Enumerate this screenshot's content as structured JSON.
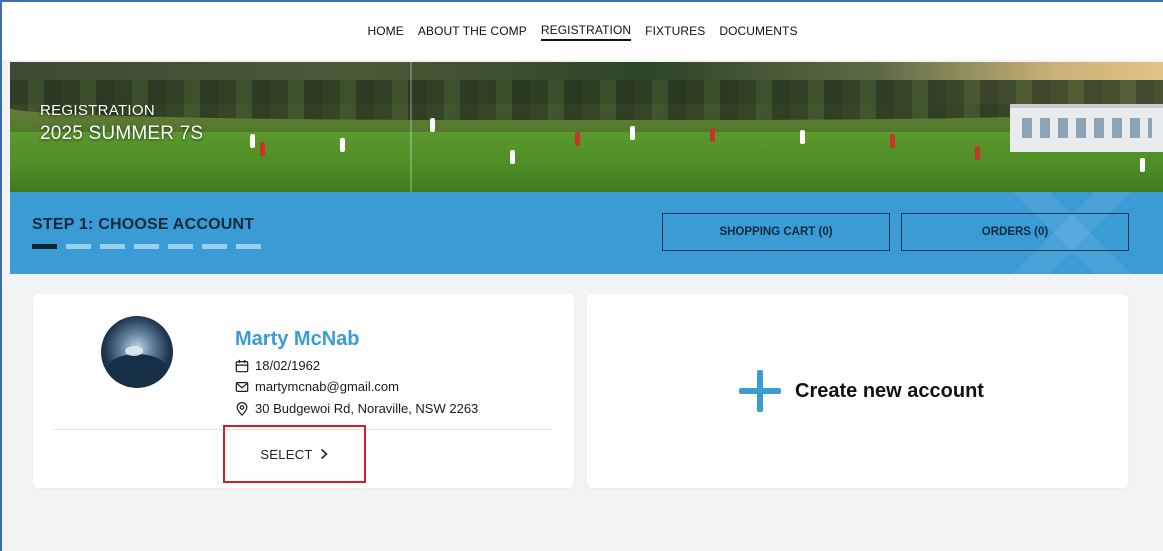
{
  "nav": {
    "items": [
      {
        "label": "HOME"
      },
      {
        "label": "ABOUT THE COMP"
      },
      {
        "label": "REGISTRATION",
        "active": true
      },
      {
        "label": "FIXTURES"
      },
      {
        "label": "DOCUMENTS"
      }
    ]
  },
  "hero": {
    "subtitle": "REGISTRATION",
    "title": "2025 SUMMER 7S"
  },
  "step": {
    "title": "STEP 1: CHOOSE ACCOUNT",
    "current": 1,
    "total": 7,
    "cart_label": "SHOPPING CART (0)",
    "orders_label": "ORDERS (0)"
  },
  "account": {
    "name": "Marty McNab",
    "dob": "18/02/1962",
    "email": "martymcnab@gmail.com",
    "address": "30 Budgewoi Rd, Noraville, NSW 2263",
    "select_label": "SELECT"
  },
  "create": {
    "label": "Create new account"
  },
  "colors": {
    "accent": "#3a9bd5",
    "highlight": "#d11f26"
  }
}
